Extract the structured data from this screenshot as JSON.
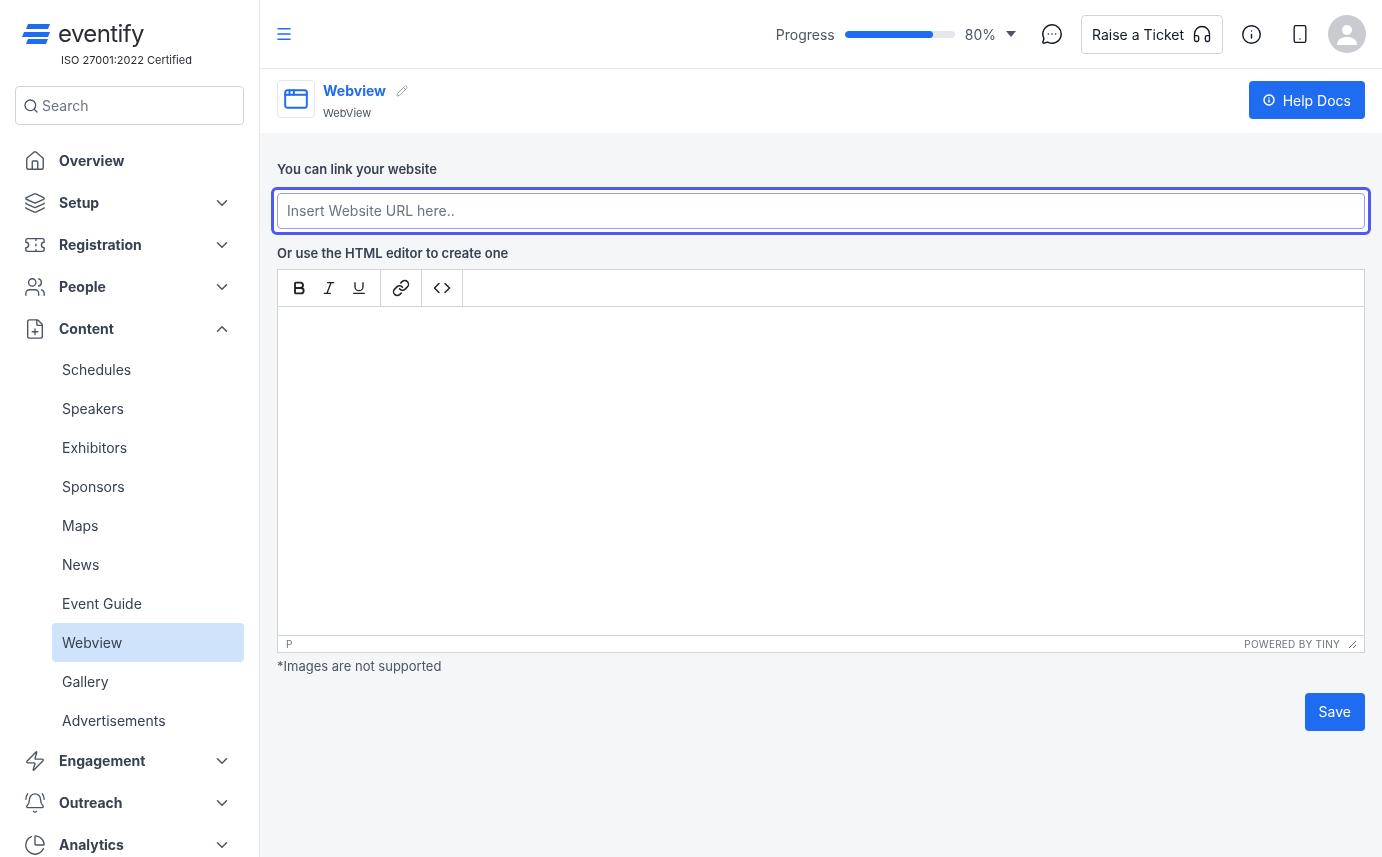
{
  "brand": {
    "name": "eventify",
    "certification": "ISO 27001:2022 Certified"
  },
  "search": {
    "placeholder": "Search"
  },
  "nav": [
    {
      "label": "Overview",
      "kind": "link"
    },
    {
      "label": "Setup",
      "kind": "group",
      "expanded": false
    },
    {
      "label": "Registration",
      "kind": "group",
      "expanded": false
    },
    {
      "label": "People",
      "kind": "group",
      "expanded": false
    },
    {
      "label": "Content",
      "kind": "group",
      "expanded": true,
      "children": [
        {
          "label": "Schedules",
          "selected": false
        },
        {
          "label": "Speakers",
          "selected": false
        },
        {
          "label": "Exhibitors",
          "selected": false
        },
        {
          "label": "Sponsors",
          "selected": false
        },
        {
          "label": "Maps",
          "selected": false
        },
        {
          "label": "News",
          "selected": false
        },
        {
          "label": "Event Guide",
          "selected": false
        },
        {
          "label": "Webview",
          "selected": true
        },
        {
          "label": "Gallery",
          "selected": false
        },
        {
          "label": "Advertisements",
          "selected": false
        }
      ]
    },
    {
      "label": "Engagement",
      "kind": "group",
      "expanded": false
    },
    {
      "label": "Outreach",
      "kind": "group",
      "expanded": false
    },
    {
      "label": "Analytics",
      "kind": "group",
      "expanded": false
    }
  ],
  "topbar": {
    "progress_label": "Progress",
    "progress": {
      "level": 0.8
    },
    "progress_reading": "80%",
    "ticket_button": "Raise a Ticket"
  },
  "page": {
    "title": "Webview",
    "subtitle": "WebView",
    "help_button": "Help Docs"
  },
  "form": {
    "url_label": "You can link your website",
    "url_placeholder": "Insert Website URL here..",
    "editor_label": "Or use the HTML editor to create one",
    "editor_status_path": "P",
    "editor_branding": "POWERED BY TINY",
    "note": "*Images are not supported",
    "save_button": "Save"
  }
}
